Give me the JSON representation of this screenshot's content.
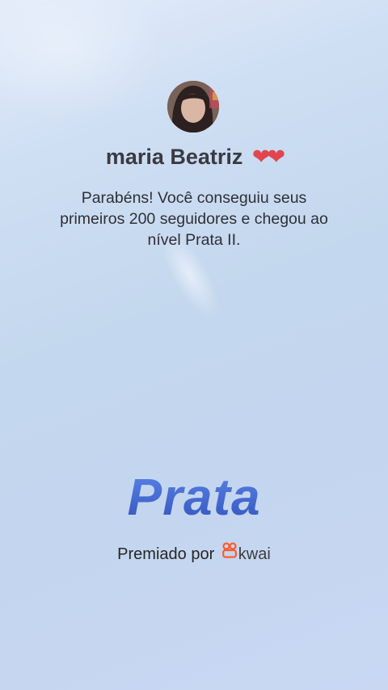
{
  "profile": {
    "username": "maria Beatriz",
    "hearts": "❤❤"
  },
  "achievement": {
    "message": "Parabéns! Você conseguiu seus primeiros 200 seguidores e chegou ao nível Prata II.",
    "tier_title": "Prata",
    "awarded_by": "Premiado por",
    "brand": "kwai"
  },
  "colors": {
    "tier_title": "#3b5fc7",
    "brand_logo": "#ff5a2c",
    "hearts": "#e0464f"
  }
}
